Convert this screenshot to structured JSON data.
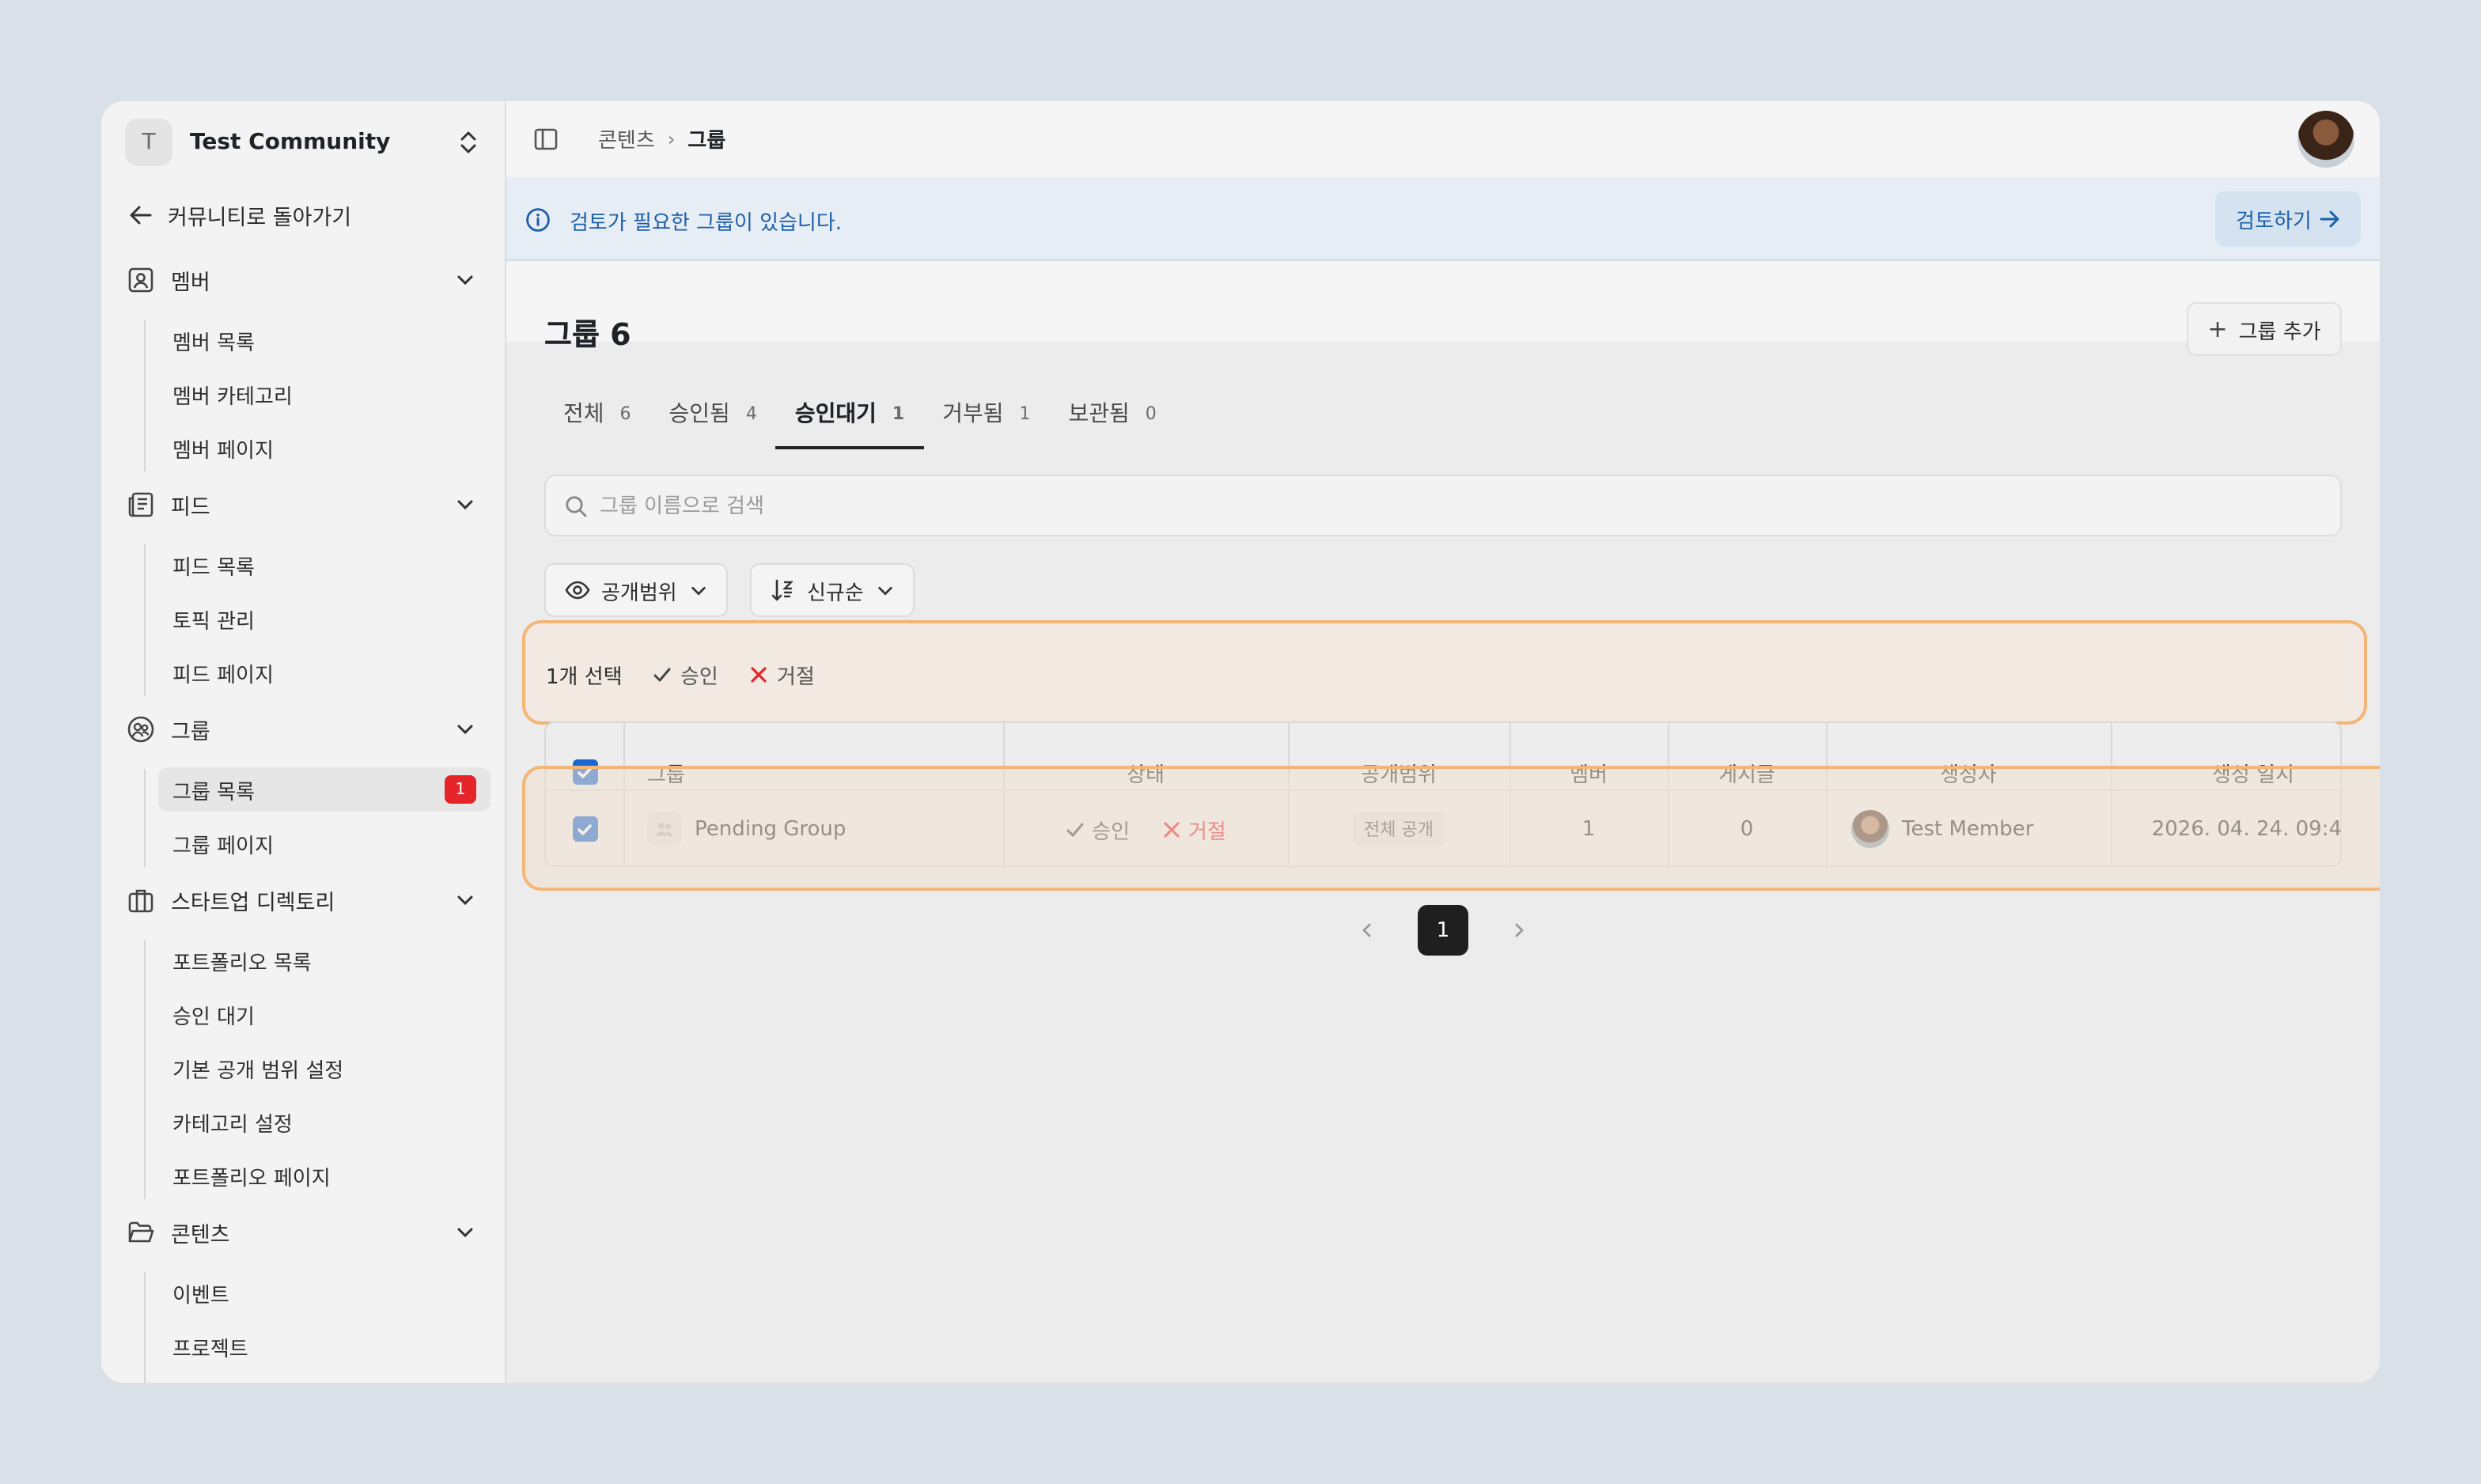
{
  "workspace": {
    "initial": "T",
    "name": "Test Community"
  },
  "sidebar": {
    "back_label": "커뮤니티로 돌아가기",
    "sections": [
      {
        "label": "멤버",
        "icon": "member-card-icon",
        "items": [
          "멤버 목록",
          "멤버 카테고리",
          "멤버 페이지"
        ]
      },
      {
        "label": "피드",
        "icon": "feed-icon",
        "items": [
          "피드 목록",
          "토픽 관리",
          "피드 페이지"
        ]
      },
      {
        "label": "그룹",
        "icon": "group-icon",
        "items": [
          "그룹 목록",
          "그룹 페이지"
        ],
        "active_item": "그룹 목록",
        "active_badge": "1"
      },
      {
        "label": "스타트업 디렉토리",
        "icon": "briefcase-icon",
        "items": [
          "포트폴리오 목록",
          "승인 대기",
          "기본 공개 범위 설정",
          "카테고리 설정",
          "포트폴리오 페이지"
        ]
      },
      {
        "label": "콘텐츠",
        "icon": "folder-icon",
        "items": [
          "이벤트",
          "프로젝트"
        ]
      }
    ]
  },
  "header": {
    "breadcrumb_parent": "콘텐츠",
    "breadcrumb_current": "그룹"
  },
  "alert": {
    "text": "검토가 필요한 그룹이 있습니다.",
    "action_label": "검토하기",
    "color": "#1d5fa8"
  },
  "main": {
    "title": "그룹 6",
    "add_label": "그룹 추가",
    "tabs": [
      {
        "label": "전체",
        "count": "6"
      },
      {
        "label": "승인됨",
        "count": "4"
      },
      {
        "label": "승인대기",
        "count": "1",
        "active": true
      },
      {
        "label": "거부됨",
        "count": "1"
      },
      {
        "label": "보관됨",
        "count": "0"
      }
    ],
    "search_placeholder": "그룹 이름으로 검색",
    "filters": {
      "visibility_label": "공개범위",
      "sort_label": "신규순"
    },
    "bulk": {
      "selected_text": "1개 선택",
      "approve_label": "승인",
      "reject_label": "거절"
    },
    "table": {
      "headers": {
        "group": "그룹",
        "status": "상태",
        "visibility": "공개범위",
        "members": "멤버",
        "posts": "게시글",
        "creator": "생성자",
        "created_at": "생성 일시"
      },
      "rows": [
        {
          "checked": true,
          "group": "Pending Group",
          "approve": "승인",
          "reject": "거절",
          "visibility": "전체 공개",
          "members": "1",
          "posts": "0",
          "creator": "Test Member",
          "created_at": "2026. 04. 24. 09:4"
        }
      ]
    },
    "pagination": {
      "current": "1"
    }
  },
  "colors": {
    "accent": "#1967d2",
    "danger": "#e5252a",
    "highlight_border": "#f3b677"
  }
}
